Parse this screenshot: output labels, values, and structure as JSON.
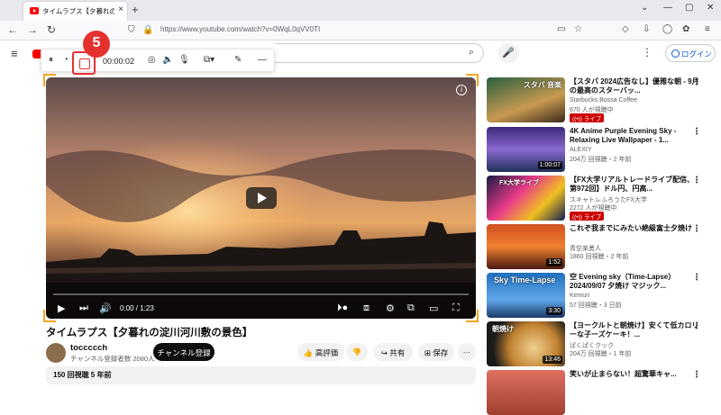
{
  "browser": {
    "tab_title": "タイムラプス【夕暮れの淀川河川敷",
    "tab_close": "×",
    "new_tab": "+",
    "window_controls": [
      "⌄",
      "—",
      "▢",
      "✕"
    ],
    "url": "https://www.youtube.com/watch?v=0WqL0qVV0TI"
  },
  "youtube": {
    "login_label": "ログイン"
  },
  "recorder": {
    "time": "00:00:02",
    "step_badge": "5"
  },
  "player": {
    "time": "0:00 / 1:23"
  },
  "video": {
    "title": "タイムラプス【夕暮れの淀川河川敷の景色】",
    "channel_name": "toccccch",
    "channel_subs": "チャンネル登録者数 2080人",
    "subscribe_label": "チャンネル登録",
    "like_label": "高評価",
    "share_label": "共有",
    "save_label": "保存",
    "more_label": "···",
    "desc_meta": "150 回視聴  5 年前"
  },
  "sidebar": [
    {
      "title": "【スタバ 2024広告なし】優雅な朝 - 9月の最高のスターバッ...",
      "channel": "Starbucks Bossa Coffee",
      "meta": "670 人が視聴中",
      "live": "ライブ",
      "duration": "",
      "overlay": "スタバ 音楽"
    },
    {
      "title": "4K Anime Purple Evening Sky - Relaxing Live Wallpaper - 1...",
      "channel": "ALEXIY",
      "meta": "204万 回視聴・2 年前",
      "live": "",
      "duration": "1:00:07",
      "overlay": ""
    },
    {
      "title": "【FX大学リアルトレードライブ配信、第972回】ドル円、円高...",
      "channel": "スキャトレふろうたFX大学",
      "meta": "2272 人が視聴中",
      "live": "ライブ",
      "duration": "",
      "overlay": "FX大学ライブ"
    },
    {
      "title": "これぞ我までにみたい絶級富士夕焼け",
      "channel": "青空楽勇人",
      "meta": "1860 回視聴・2 年前",
      "live": "",
      "duration": "1:52",
      "overlay": ""
    },
    {
      "title": "空 Evening sky（Time-Lapse）2024/09/07 夕焼け マジック...",
      "channel": "Kemuri",
      "meta": "57 回視聴・3 日前",
      "live": "",
      "duration": "3:30",
      "overlay": "Sky Time-Lapse"
    },
    {
      "title": "【ヨークルトと朝焼け】安くて低カロリーな子ーズケーキ！...",
      "channel": "ぱくぱくクック",
      "meta": "204万 回視聴・1 年前",
      "live": "",
      "duration": "13:46",
      "overlay": "朝焼け"
    },
    {
      "title": "笑いが止まらない！超驚華キャ...",
      "channel": "",
      "meta": "",
      "live": "",
      "duration": "",
      "overlay": ""
    }
  ]
}
